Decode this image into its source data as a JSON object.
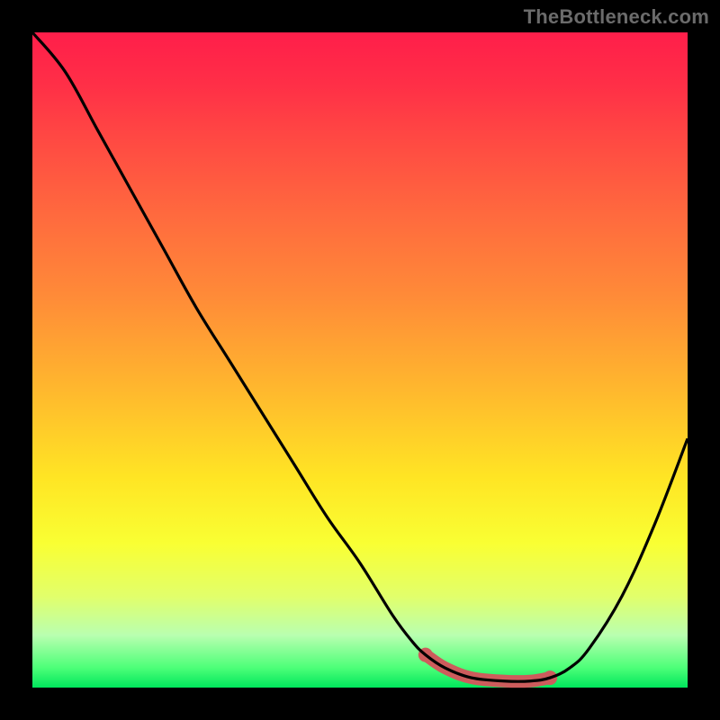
{
  "credit_text": "TheBottleneck.com",
  "chart_data": {
    "type": "line",
    "title": "",
    "xlabel": "",
    "ylabel": "",
    "xlim": [
      0,
      1
    ],
    "ylim": [
      0,
      1
    ],
    "series": [
      {
        "name": "bottleneck-curve",
        "x": [
          0.0,
          0.05,
          0.1,
          0.15,
          0.2,
          0.25,
          0.3,
          0.35,
          0.4,
          0.45,
          0.5,
          0.55,
          0.58,
          0.6,
          0.63,
          0.67,
          0.72,
          0.76,
          0.79,
          0.82,
          0.85,
          0.9,
          0.95,
          1.0
        ],
        "y": [
          1.0,
          0.94,
          0.85,
          0.76,
          0.67,
          0.58,
          0.5,
          0.42,
          0.34,
          0.26,
          0.19,
          0.11,
          0.07,
          0.05,
          0.03,
          0.015,
          0.01,
          0.01,
          0.015,
          0.03,
          0.06,
          0.14,
          0.25,
          0.38
        ]
      },
      {
        "name": "highlight-segment",
        "x": [
          0.6,
          0.63,
          0.67,
          0.72,
          0.76,
          0.79
        ],
        "y": [
          0.05,
          0.03,
          0.015,
          0.01,
          0.01,
          0.015
        ]
      }
    ],
    "grid": false,
    "legend": false
  }
}
